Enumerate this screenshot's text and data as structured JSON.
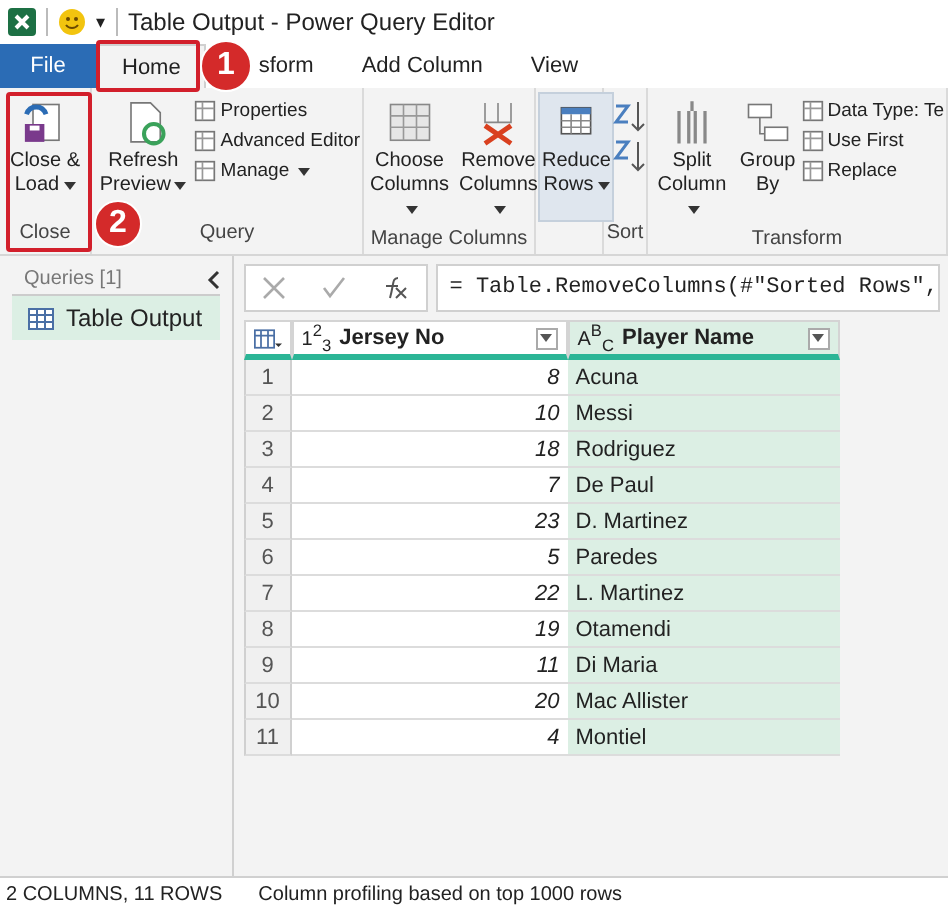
{
  "title_bar": {
    "quick_access_glyph": "▾",
    "title": "Table Output - Power Query Editor"
  },
  "tabs": [
    {
      "label": "File",
      "kind": "file",
      "selected": false
    },
    {
      "label": "Home",
      "kind": "tab",
      "selected": true
    },
    {
      "label": "sform",
      "kind": "tab",
      "selected": false
    },
    {
      "label": "Add Column",
      "kind": "tab",
      "selected": false
    },
    {
      "label": "View",
      "kind": "tab",
      "selected": false
    }
  ],
  "annotations": [
    {
      "label": "1"
    },
    {
      "label": "2"
    }
  ],
  "ribbon": {
    "groups": [
      {
        "label": "Close",
        "buttons": [
          {
            "label": "Close & Load",
            "kind": "large",
            "dropdown": true
          }
        ]
      },
      {
        "label": "Query",
        "buttons": [
          {
            "label": "Refresh Preview",
            "kind": "large",
            "dropdown": true
          },
          {
            "label": "Properties",
            "kind": "small",
            "dropdown": false
          },
          {
            "label": "Advanced Editor",
            "kind": "small",
            "dropdown": false
          },
          {
            "label": "Manage",
            "kind": "small",
            "dropdown": true
          }
        ]
      },
      {
        "label": "Manage Columns",
        "buttons": [
          {
            "label": "Choose Columns",
            "kind": "large",
            "dropdown": true
          },
          {
            "label": "Remove Columns",
            "kind": "large",
            "dropdown": true
          }
        ]
      },
      {
        "buttons": [
          {
            "label": "Reduce Rows",
            "kind": "large",
            "dropdown": true,
            "pressed": true
          }
        ]
      },
      {
        "label": "Sort",
        "buttons": [
          {
            "kind": "sort"
          }
        ]
      },
      {
        "label": "Transform",
        "buttons": [
          {
            "label": "Split Column",
            "kind": "large",
            "dropdown": true
          },
          {
            "label": "Group By",
            "kind": "large",
            "dropdown": false
          },
          {
            "label": "Data Type: Te",
            "kind": "small",
            "dropdown": false
          },
          {
            "label": "Use First",
            "kind": "small",
            "dropdown": false
          },
          {
            "label": "Replace",
            "kind": "small",
            "dropdown": false
          }
        ]
      }
    ]
  },
  "queries": {
    "header": "Queries [1]",
    "items": [
      {
        "label": "Table Output",
        "selected": true
      }
    ]
  },
  "formula_bar": {
    "formula": "= Table.RemoveColumns(#\"Sorted Rows\","
  },
  "table": {
    "columns": [
      {
        "name": "Jersey No",
        "type_label": "1$^{2}$$_{3}$",
        "selected": false
      },
      {
        "name": "Player Name",
        "type_label": "A$^{B}$$_{C}$",
        "selected": true
      }
    ],
    "rows": [
      {
        "index": "1",
        "jersey": "8",
        "player": "Acuna"
      },
      {
        "index": "2",
        "jersey": "10",
        "player": "Messi"
      },
      {
        "index": "3",
        "jersey": "18",
        "player": "Rodriguez"
      },
      {
        "index": "4",
        "jersey": "7",
        "player": "De Paul"
      },
      {
        "index": "5",
        "jersey": "23",
        "player": "D. Martinez"
      },
      {
        "index": "6",
        "jersey": "5",
        "player": "Paredes"
      },
      {
        "index": "7",
        "jersey": "22",
        "player": "L. Martinez"
      },
      {
        "index": "8",
        "jersey": "19",
        "player": "Otamendi"
      },
      {
        "index": "9",
        "jersey": "11",
        "player": "Di Maria"
      },
      {
        "index": "10",
        "jersey": "20",
        "player": "Mac Allister"
      },
      {
        "index": "11",
        "jersey": "4",
        "player": "Montiel"
      }
    ]
  },
  "status_bar": [
    "2 COLUMNS, 11 ROWS",
    "Column profiling based on top 1000 rows"
  ]
}
